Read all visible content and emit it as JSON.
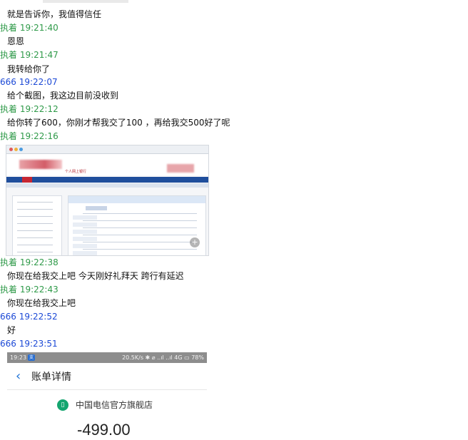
{
  "chat": {
    "messages": [
      {
        "type": "text",
        "text": "就是告诉你，我值得信任"
      },
      {
        "type": "sender",
        "sender": "执着 19:21:40"
      },
      {
        "type": "text",
        "text": "恩恩"
      },
      {
        "type": "sender",
        "sender": "执着 19:21:47"
      },
      {
        "type": "text",
        "text": "我转给你了"
      },
      {
        "type": "sender",
        "sender": "666 19:22:07"
      },
      {
        "type": "text",
        "text": "给个截图，我这边目前没收到"
      },
      {
        "type": "sender",
        "sender": "执着 19:22:12"
      },
      {
        "type": "text",
        "text": "给你转了600，你刚才帮我交了100    ，再给我交500好了呢"
      },
      {
        "type": "sender",
        "sender": "执着 19:22:16"
      },
      {
        "type": "sender",
        "sender": "执着 19:22:38"
      },
      {
        "type": "text",
        "text": "你现在给我交上吧   今天刚好礼拜天  跨行有延迟"
      },
      {
        "type": "sender",
        "sender": "执着 19:22:43"
      },
      {
        "type": "text",
        "text": "你现在给我交上吧"
      },
      {
        "type": "sender",
        "sender": "666 19:22:52"
      },
      {
        "type": "text",
        "text": "好"
      },
      {
        "type": "sender",
        "sender": "666 19:23:51"
      }
    ]
  },
  "bank_screenshot": {
    "title": "个人网上银行",
    "zoom_icon": "magnifier-plus-icon"
  },
  "phone_screenshot": {
    "status_time": "19:23",
    "status_badge": "支",
    "status_right": "20.5K/s  ✱  ⌀  ..ıl  ..ıl  4G  ▭ 78%",
    "back_icon": "‹",
    "page_title": "账单详情",
    "merchant_icon_glyph": "▯",
    "merchant": "中国电信官方旗舰店",
    "amount": "-499.00"
  },
  "colors": {
    "sender_green": "#2f9a49",
    "sender_blue": "#1c49d6"
  }
}
